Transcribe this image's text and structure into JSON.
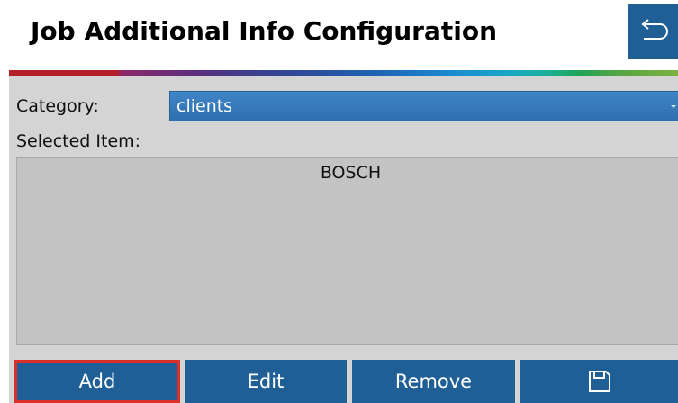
{
  "header": {
    "title": "Job Additional Info Configuration",
    "back_icon": "back-arrow-icon"
  },
  "form": {
    "category_label": "Category:",
    "category_value": "clients",
    "selected_item_label": "Selected Item:"
  },
  "list": {
    "items": [
      "BOSCH"
    ]
  },
  "buttons": {
    "add_label": "Add",
    "edit_label": "Edit",
    "remove_label": "Remove",
    "save_icon": "save-icon"
  },
  "colors": {
    "button_blue": "#1f5f96",
    "select_blue": "#2e6fae",
    "focus_red": "#d9302a",
    "panel_gray": "#d4d4d4"
  }
}
